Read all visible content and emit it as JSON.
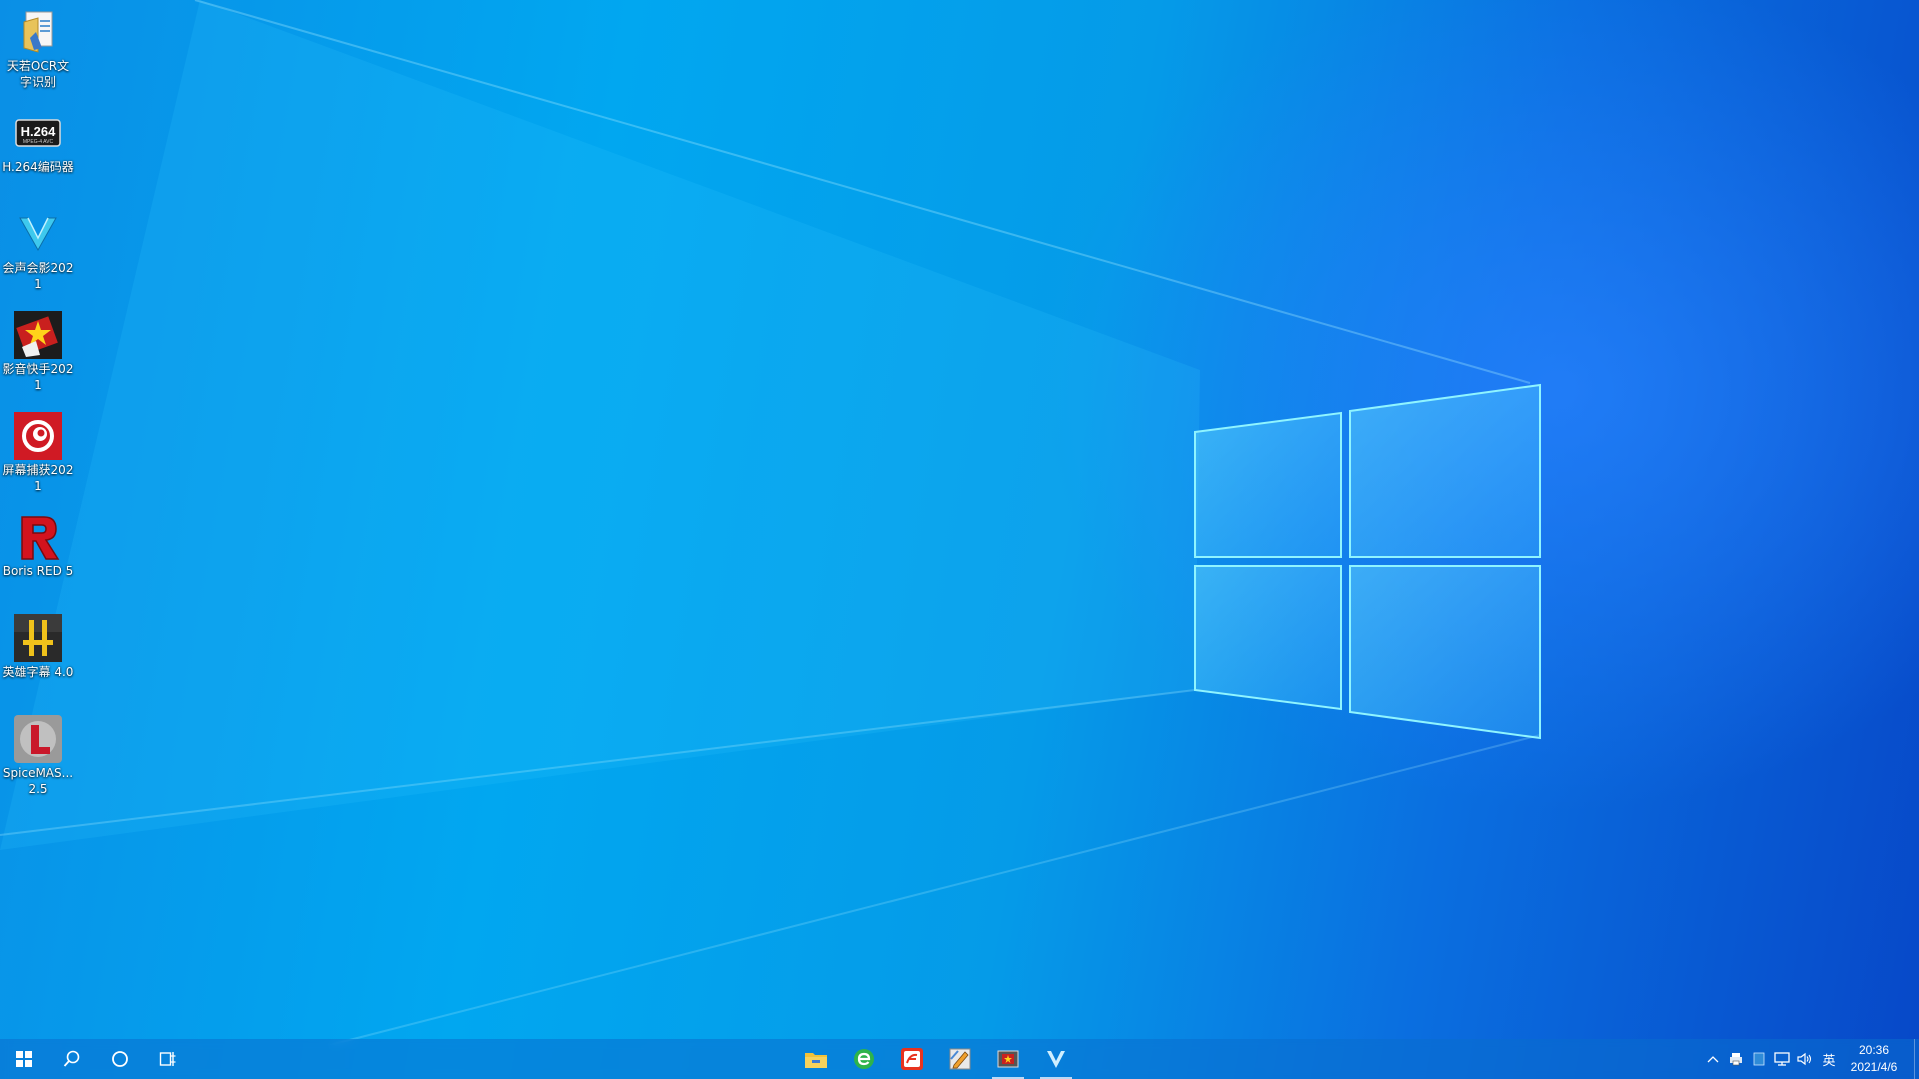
{
  "desktop": {
    "icons": [
      {
        "label": "天若OCR文字识别",
        "icon": "folder-doc-icon"
      },
      {
        "label": "H.264编码器",
        "icon": "h264-icon"
      },
      {
        "label": "会声会影2021",
        "icon": "videostudio-v-icon"
      },
      {
        "label": "影音快手2021",
        "icon": "film-star-icon"
      },
      {
        "label": "屏幕捕获2021",
        "icon": "screen-capture-icon"
      },
      {
        "label": "Boris RED 5",
        "icon": "boris-red-r-icon"
      },
      {
        "label": "英雄字幕 4.0",
        "icon": "hero-subtitle-icon"
      },
      {
        "label": "SpiceMAS...2.5",
        "icon": "spicemaster-l-icon"
      }
    ],
    "h264_text": "H.264",
    "h264_sub": "MPEG-4 AVC"
  },
  "taskbar": {
    "start": "start-icon",
    "search": "search-icon",
    "cortana": "cortana-icon",
    "taskview": "task-view-icon",
    "pinned": [
      "file-explorer-icon",
      "browser-e-icon",
      "red-app-icon",
      "edit-tool-icon",
      "film-app-icon",
      "videostudio-icon"
    ],
    "tray": {
      "chevron": "^",
      "ime": "英"
    },
    "clock": {
      "time": "20:36",
      "date": "2021/4/6"
    }
  },
  "colors": {
    "accent": "#0a7fe0",
    "wallpaper_dark": "#0748c8",
    "wallpaper_light": "#01a7f0"
  }
}
